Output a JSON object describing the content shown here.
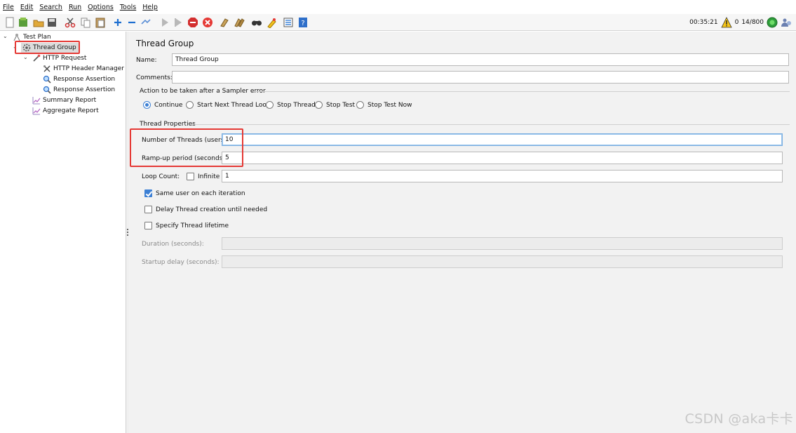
{
  "menu": [
    "File",
    "Edit",
    "Search",
    "Run",
    "Options",
    "Tools",
    "Help"
  ],
  "toolbar": {
    "icons": [
      "new-icon",
      "templates-icon",
      "open-icon",
      "save-icon",
      "cut-icon",
      "copy-icon",
      "paste-icon",
      "expand-icon",
      "collapse-icon",
      "toggle-icon",
      "start-icon",
      "start-no-pause-icon",
      "stop-icon",
      "shutdown-icon",
      "clear-icon",
      "clear-all-icon",
      "search-icon",
      "reset-search-icon",
      "function-helper-icon",
      "help-icon"
    ],
    "elapsed_time": "00:35:21",
    "warning_count": "0",
    "threads": "14/800"
  },
  "tree": {
    "test_plan": "Test Plan",
    "thread_group": "Thread Group",
    "http_request": "HTTP Request",
    "http_header_manager": "HTTP Header Manager",
    "response_assertion_1": "Response Assertion",
    "response_assertion_2": "Response Assertion",
    "summary_report": "Summary Report",
    "aggregate_report": "Aggregate Report"
  },
  "panel": {
    "title": "Thread Group",
    "name_label": "Name:",
    "name_value": "Thread Group",
    "comments_label": "Comments:",
    "comments_value": "",
    "sampler_error_title": "Action to be taken after a Sampler error",
    "sampler_options": [
      "Continue",
      "Start Next Thread Loop",
      "Stop Thread",
      "Stop Test",
      "Stop Test Now"
    ],
    "sampler_selected": "Continue",
    "thread_props_title": "Thread Properties",
    "num_threads_label": "Number of Threads (users):",
    "num_threads_value": "10",
    "rampup_label": "Ramp-up period (seconds):",
    "rampup_value": "5",
    "loop_count_label": "Loop Count:",
    "infinite_label": "Infinite",
    "infinite_checked": false,
    "loop_count_value": "1",
    "same_user_label": "Same user on each iteration",
    "same_user_checked": true,
    "delay_thread_label": "Delay Thread creation until needed",
    "delay_thread_checked": false,
    "specify_lifetime_label": "Specify Thread lifetime",
    "specify_lifetime_checked": false,
    "duration_label": "Duration (seconds):",
    "duration_value": "",
    "startup_delay_label": "Startup delay (seconds):",
    "startup_delay_value": ""
  },
  "watermark": "CSDN @aka卡卡",
  "colors": {
    "accent": "#3b7fd4",
    "highlight_box": "#e53935",
    "panel_bg": "#f2f2f2",
    "selection_bg": "#dcdcdc"
  }
}
